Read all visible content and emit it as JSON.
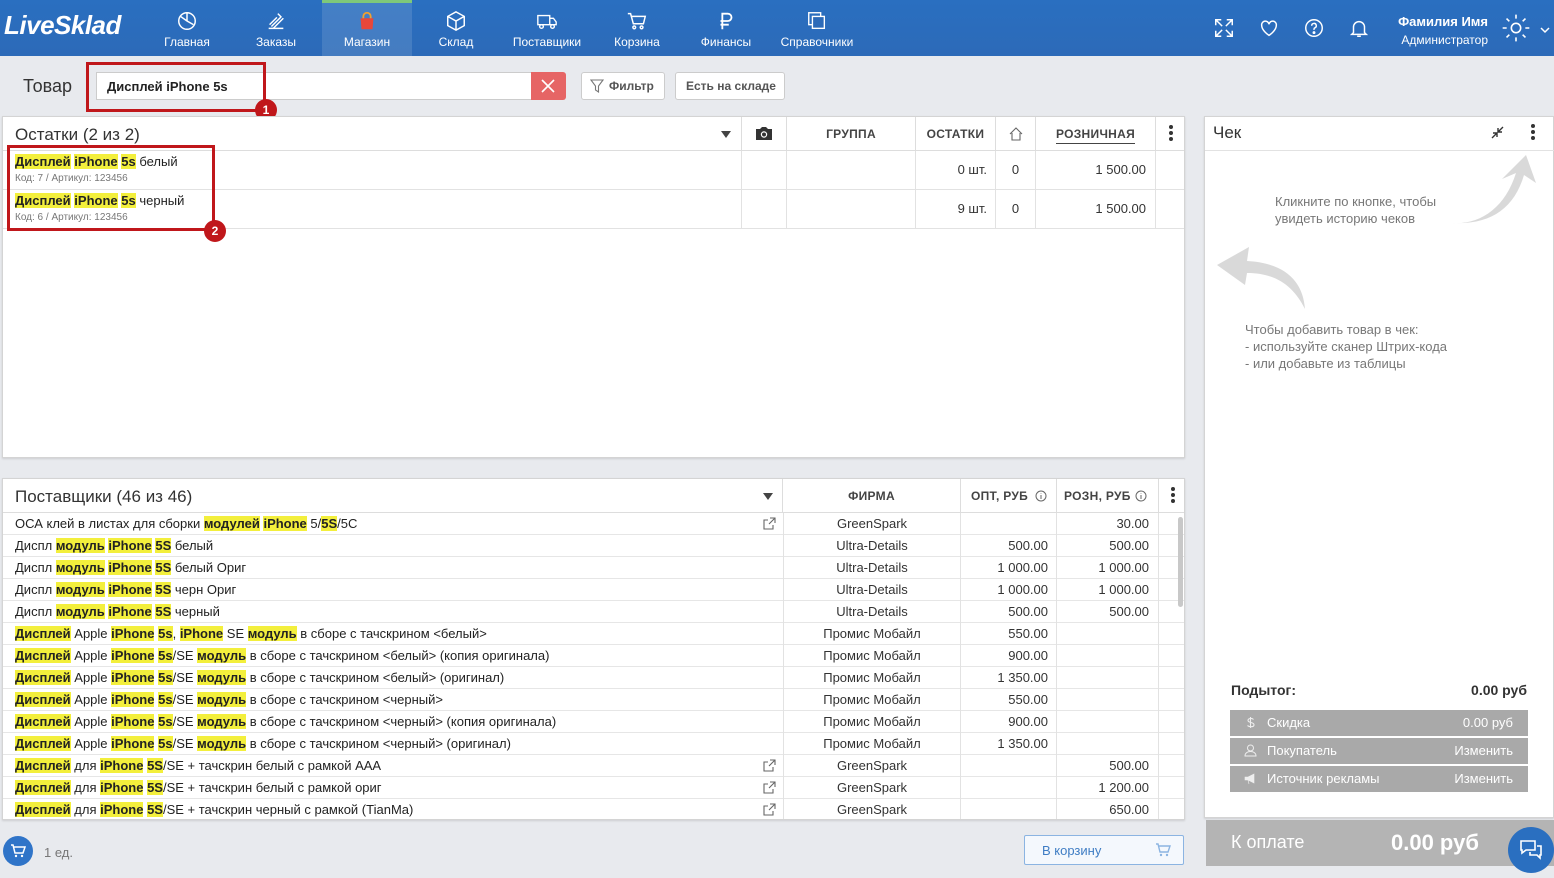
{
  "app": {
    "logo": "LiveSklad"
  },
  "nav": [
    {
      "label": "Главная",
      "icon": "dashboard-icon"
    },
    {
      "label": "Заказы",
      "icon": "orders-icon"
    },
    {
      "label": "Магазин",
      "icon": "shop-bag-icon",
      "active": true
    },
    {
      "label": "Склад",
      "icon": "box-icon"
    },
    {
      "label": "Поставщики",
      "icon": "truck-icon"
    },
    {
      "label": "Корзина",
      "icon": "cart-icon"
    },
    {
      "label": "Финансы",
      "icon": "ruble-icon"
    },
    {
      "label": "Справочники",
      "icon": "catalogs-icon"
    }
  ],
  "user": {
    "name": "Фамилия Имя",
    "role": "Администратор"
  },
  "search": {
    "label": "Товар",
    "value": "Дисплей iPhone 5s",
    "filter_label": "Фильтр",
    "stock_label": "Есть на складе"
  },
  "callouts": [
    "1",
    "2"
  ],
  "stock": {
    "title": "Остатки (2 из 2)",
    "columns": {
      "group": "ГРУППА",
      "remains": "ОСТАТКИ",
      "retail": "РОЗНИЧНАЯ"
    },
    "rows": [
      {
        "name_parts": [
          "Дисплей",
          " ",
          "iPhone",
          " ",
          "5s",
          " белый"
        ],
        "code": "Код: 7 /  Артикул: 123456",
        "remains": "0 шт.",
        "store": "0",
        "retail": "1 500.00"
      },
      {
        "name_parts": [
          "Дисплей",
          " ",
          "iPhone",
          " ",
          "5s",
          " черный"
        ],
        "code": "Код: 6 /  Артикул: 123456",
        "remains": "9 шт.",
        "store": "0",
        "retail": "1 500.00"
      }
    ]
  },
  "suppliers": {
    "title": "Поставщики (46 из 46)",
    "columns": {
      "firm": "ФИРМА",
      "opt": "ОПТ, РУБ",
      "rozn": "РОЗН, РУБ"
    },
    "rows": [
      {
        "parts": [
          "ОСА клей в листах для сборки ",
          {
            "h": "модулей"
          },
          " ",
          {
            "h": "iPhone"
          },
          " 5/",
          {
            "h": "5S"
          },
          "/5C"
        ],
        "link": true,
        "firm": "GreenSpark",
        "opt": "",
        "rozn": "30.00"
      },
      {
        "parts": [
          "Диспл ",
          {
            "h": "модуль"
          },
          " ",
          {
            "h": "iPhone"
          },
          " ",
          {
            "h": "5S"
          },
          " белый"
        ],
        "link": false,
        "firm": "Ultra-Details",
        "opt": "500.00",
        "rozn": "500.00"
      },
      {
        "parts": [
          "Диспл ",
          {
            "h": "модуль"
          },
          " ",
          {
            "h": "iPhone"
          },
          " ",
          {
            "h": "5S"
          },
          " белый Ориг"
        ],
        "link": false,
        "firm": "Ultra-Details",
        "opt": "1 000.00",
        "rozn": "1 000.00"
      },
      {
        "parts": [
          "Диспл ",
          {
            "h": "модуль"
          },
          " ",
          {
            "h": "iPhone"
          },
          " ",
          {
            "h": "5S"
          },
          " черн Ориг"
        ],
        "link": false,
        "firm": "Ultra-Details",
        "opt": "1 000.00",
        "rozn": "1 000.00"
      },
      {
        "parts": [
          "Диспл ",
          {
            "h": "модуль"
          },
          " ",
          {
            "h": "iPhone"
          },
          " ",
          {
            "h": "5S"
          },
          " черный"
        ],
        "link": false,
        "firm": "Ultra-Details",
        "opt": "500.00",
        "rozn": "500.00"
      },
      {
        "parts": [
          {
            "h": "Дисплей"
          },
          " Apple ",
          {
            "h": "iPhone"
          },
          " ",
          {
            "h": "5s"
          },
          ", ",
          {
            "h": "iPhone"
          },
          " SE ",
          {
            "h": "модуль"
          },
          " в сборе с тачскрином <белый>"
        ],
        "link": false,
        "firm": "Промис Мобайл",
        "opt": "550.00",
        "rozn": ""
      },
      {
        "parts": [
          {
            "h": "Дисплей"
          },
          " Apple ",
          {
            "h": "iPhone"
          },
          " ",
          {
            "h": "5s"
          },
          "/SE ",
          {
            "h": "модуль"
          },
          " в сборе с тачскрином <белый> (копия оригинала)"
        ],
        "link": false,
        "firm": "Промис Мобайл",
        "opt": "900.00",
        "rozn": ""
      },
      {
        "parts": [
          {
            "h": "Дисплей"
          },
          " Apple ",
          {
            "h": "iPhone"
          },
          " ",
          {
            "h": "5s"
          },
          "/SE ",
          {
            "h": "модуль"
          },
          " в сборе с тачскрином <белый> (оригинал)"
        ],
        "link": false,
        "firm": "Промис Мобайл",
        "opt": "1 350.00",
        "rozn": ""
      },
      {
        "parts": [
          {
            "h": "Дисплей"
          },
          " Apple ",
          {
            "h": "iPhone"
          },
          " ",
          {
            "h": "5s"
          },
          "/SE ",
          {
            "h": "модуль"
          },
          " в сборе с тачскрином <черный>"
        ],
        "link": false,
        "firm": "Промис Мобайл",
        "opt": "550.00",
        "rozn": ""
      },
      {
        "parts": [
          {
            "h": "Дисплей"
          },
          " Apple ",
          {
            "h": "iPhone"
          },
          " ",
          {
            "h": "5s"
          },
          "/SE ",
          {
            "h": "модуль"
          },
          " в сборе с тачскрином <черный> (копия оригинала)"
        ],
        "link": false,
        "firm": "Промис Мобайл",
        "opt": "900.00",
        "rozn": ""
      },
      {
        "parts": [
          {
            "h": "Дисплей"
          },
          " Apple ",
          {
            "h": "iPhone"
          },
          " ",
          {
            "h": "5s"
          },
          "/SE ",
          {
            "h": "модуль"
          },
          " в сборе с тачскрином <черный> (оригинал)"
        ],
        "link": false,
        "firm": "Промис Мобайл",
        "opt": "1 350.00",
        "rozn": ""
      },
      {
        "parts": [
          {
            "h": "Дисплей"
          },
          " для ",
          {
            "h": "iPhone"
          },
          " ",
          {
            "h": "5S"
          },
          "/SE + тачскрин белый с рамкой AAA"
        ],
        "link": true,
        "firm": "GreenSpark",
        "opt": "",
        "rozn": "500.00"
      },
      {
        "parts": [
          {
            "h": "Дисплей"
          },
          " для ",
          {
            "h": "iPhone"
          },
          " ",
          {
            "h": "5S"
          },
          "/SE + тачскрин белый с рамкой ориг"
        ],
        "link": true,
        "firm": "GreenSpark",
        "opt": "",
        "rozn": "1 200.00"
      },
      {
        "parts": [
          {
            "h": "Дисплей"
          },
          " для ",
          {
            "h": "iPhone"
          },
          " ",
          {
            "h": "5S"
          },
          "/SE + тачскрин черный с рамкой (TianMa)"
        ],
        "link": true,
        "firm": "GreenSpark",
        "opt": "",
        "rozn": "650.00"
      }
    ]
  },
  "check": {
    "title": "Чек",
    "history_hint": "Кликните по кнопке, чтобы\nувидеть историю чеков",
    "add_hint": "Чтобы добавить товар в чек:\n- используйте сканер Штрих-кода\n- или добавьте из таблицы",
    "subtotal_label": "Подытог:",
    "subtotal_value": "0.00 руб",
    "discount_label": "Скидка",
    "discount_value": "0.00 руб",
    "buyer_label": "Покупатель",
    "buyer_action": "Изменить",
    "ad_source_label": "Источник рекламы",
    "ad_source_action": "Изменить",
    "pay_label": "К оплате",
    "pay_value": "0.00 руб"
  },
  "footer": {
    "count": "1 ед.",
    "to_cart": "В корзину"
  },
  "colors": {
    "topbar": "#2c6ab8",
    "highlight": "#f3ef3c",
    "callout": "#c0171b",
    "clear": "#e66565"
  }
}
